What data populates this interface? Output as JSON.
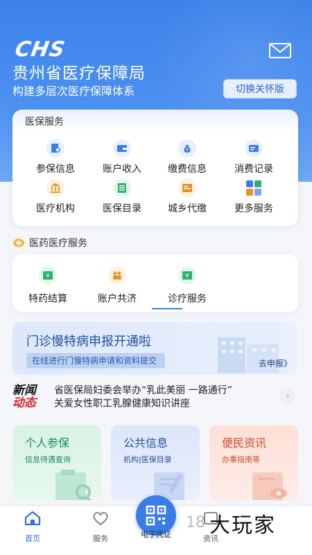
{
  "header": {
    "logo": "CHS",
    "title": "贵州省医疗保障局",
    "slogan": "构建多层次医疗保障体系",
    "care_button": "切换关怀版",
    "mail_icon": "mail-icon"
  },
  "medical_insurance": {
    "title": "医保服务",
    "items": [
      {
        "label": "参保信息",
        "icon": "document-search-icon",
        "color": "#3a7de6"
      },
      {
        "label": "账户收入",
        "icon": "wallet-icon",
        "color": "#3a7de6"
      },
      {
        "label": "缴费信息",
        "icon": "money-bag-icon",
        "color": "#3a7de6"
      },
      {
        "label": "消费记录",
        "icon": "card-record-icon",
        "color": "#3a7de6"
      },
      {
        "label": "医疗机构",
        "icon": "institution-icon",
        "color": "#e8902a"
      },
      {
        "label": "医保目录",
        "icon": "list-icon",
        "color": "#2fb070"
      },
      {
        "label": "城乡代缴",
        "icon": "receipt-icon",
        "color": "#e8902a"
      },
      {
        "label": "更多服务",
        "icon": "grid-icon",
        "color": "#3a7de6"
      }
    ]
  },
  "pharma_service": {
    "title": "医药医疗服务",
    "items": [
      {
        "label": "特药结算",
        "icon": "bill-icon",
        "color": "#2fb070"
      },
      {
        "label": "账户共济",
        "icon": "family-icon",
        "color": "#e8902a"
      },
      {
        "label": "诊疗服务",
        "icon": "bill-icon",
        "color": "#2fb070"
      }
    ]
  },
  "banner": {
    "title": "门诊慢特病申报开通啦",
    "subtitle": "在线进行门慢特病申请和资料提交",
    "action": "去申报》"
  },
  "news": {
    "logo_line1": "新闻",
    "logo_line2": "动态",
    "line1": "省医保局妇委会举办“乳此美丽 一路通行”",
    "line2": "关爱女性职工乳腺健康知识讲座",
    "more": "›"
  },
  "tiles": [
    {
      "title": "个人参保",
      "subtitle": "信息待遇查询"
    },
    {
      "title": "公共信息",
      "subtitle": "机构|医保目录"
    },
    {
      "title": "便民资讯",
      "subtitle": "办事指南等"
    }
  ],
  "tabbar": {
    "home": "首页",
    "service": "服务",
    "ecert": "电子凭证",
    "info": "资讯"
  },
  "watermark": {
    "number": "18",
    "text": "大玩家"
  }
}
